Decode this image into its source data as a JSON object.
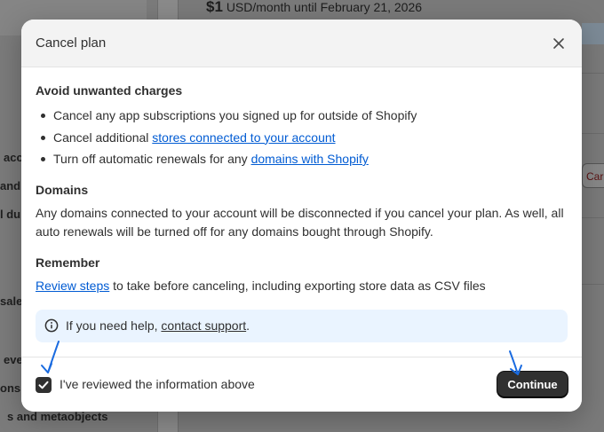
{
  "background": {
    "price_amount": "$1",
    "price_suffix": "USD/month until February 21, 2026",
    "cancel_fragment": "Car",
    "sidebar_fragments": [
      "acc",
      "and",
      "l du",
      "sale",
      "eve",
      "ons",
      "s and metaobjects"
    ]
  },
  "modal": {
    "title": "Cancel plan",
    "sections": {
      "charges": {
        "title": "Avoid unwanted charges",
        "items": [
          {
            "text": "Cancel any app subscriptions you signed up for outside of Shopify",
            "link": ""
          },
          {
            "text": "Cancel additional ",
            "link": "stores connected to your account"
          },
          {
            "text": "Turn off automatic renewals for any ",
            "link": "domains with Shopify"
          }
        ]
      },
      "domains": {
        "title": "Domains",
        "body": "Any domains connected to your account will be disconnected if you cancel your plan. As well, all auto renewals will be turned off for any domains bought through Shopify."
      },
      "remember": {
        "title": "Remember",
        "link": "Review steps",
        "body": " to take before canceling, including exporting store data as CSV files"
      }
    },
    "banner": {
      "text": "If you need help, ",
      "link": "contact support",
      "suffix": "."
    },
    "footer": {
      "checkbox_label": "I've reviewed the information above",
      "checkbox_checked": true,
      "continue_label": "Continue"
    }
  },
  "colors": {
    "link": "#005bd3",
    "banner_bg": "#eaf4ff",
    "primary_button": "#303030",
    "annotation_arrow": "#1a6be0"
  }
}
